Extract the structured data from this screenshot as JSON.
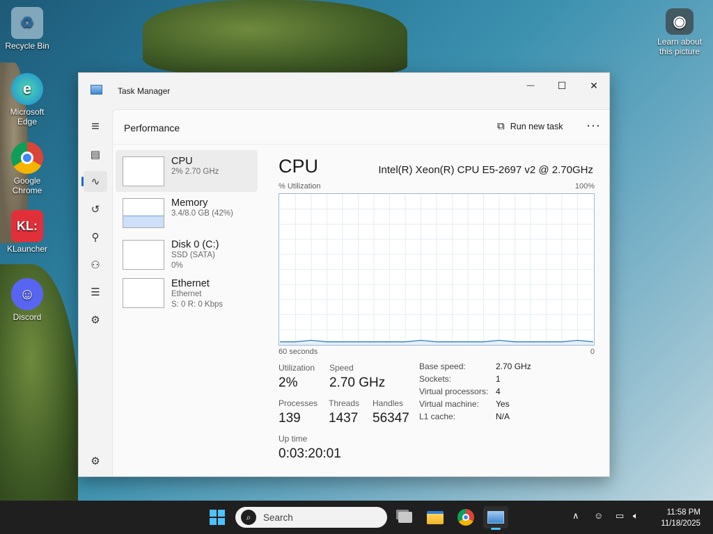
{
  "desktop": {
    "icons": [
      {
        "label": "Recycle Bin",
        "glyph": "♻",
        "color": "#9fb8cf"
      },
      {
        "label": "Microsoft Edge",
        "glyph": "e",
        "color": "#1b8ad6"
      },
      {
        "label": "Google Chrome",
        "glyph": "◎",
        "color": "#2f8a3f"
      },
      {
        "label": "KLauncher",
        "glyph": "KL",
        "color": "#e2303a"
      },
      {
        "label": "Discord",
        "glyph": "☺",
        "color": "#5865f2"
      }
    ],
    "learn_about": "Learn about this picture"
  },
  "window": {
    "title": "Task Manager",
    "controls": {
      "minimize": "—",
      "maximize": "☐",
      "close": "✕"
    }
  },
  "nav": {
    "items": [
      {
        "name": "hamburger-icon",
        "glyph": "≡"
      },
      {
        "name": "processes-icon",
        "glyph": "▤"
      },
      {
        "name": "performance-icon",
        "glyph": "∿"
      },
      {
        "name": "app-history-icon",
        "glyph": "↺"
      },
      {
        "name": "startup-apps-icon",
        "glyph": "⚲"
      },
      {
        "name": "users-icon",
        "glyph": "⚇"
      },
      {
        "name": "details-icon",
        "glyph": "☰"
      },
      {
        "name": "services-icon",
        "glyph": "⚙"
      },
      {
        "name": "settings-icon",
        "glyph": "⚙"
      }
    ]
  },
  "page": {
    "title": "Performance",
    "run_new_task": "Run new task",
    "more": "···"
  },
  "resources": [
    {
      "name": "CPU",
      "sub1": "2% 2.70 GHz",
      "sub2": "",
      "sub3": ""
    },
    {
      "name": "Memory",
      "sub1": "3.4/8.0 GB (42%)",
      "sub2": "",
      "sub3": ""
    },
    {
      "name": "Disk 0 (C:)",
      "sub1": "SSD (SATA)",
      "sub2": "0%",
      "sub3": ""
    },
    {
      "name": "Ethernet",
      "sub1": "Ethernet",
      "sub2": "S: 0 R: 0 Kbps",
      "sub3": ""
    }
  ],
  "memory_usage_fraction": 0.42,
  "detail": {
    "title": "CPU",
    "model": "Intel(R) Xeon(R) CPU E5-2697 v2 @ 2.70GHz",
    "y_label": "% Utilization",
    "y_max": "100%",
    "x_label": "60 seconds",
    "x_min": "0",
    "stats": {
      "utilization": {
        "k": "Utilization",
        "v": "2%"
      },
      "speed": {
        "k": "Speed",
        "v": "2.70 GHz"
      },
      "processes": {
        "k": "Processes",
        "v": "139"
      },
      "threads": {
        "k": "Threads",
        "v": "1437"
      },
      "handles": {
        "k": "Handles",
        "v": "56347"
      },
      "uptime": {
        "k": "Up time",
        "v": "0:03:20:01"
      }
    },
    "specs": [
      {
        "k": "Base speed:",
        "v": "2.70 GHz"
      },
      {
        "k": "Sockets:",
        "v": "1"
      },
      {
        "k": "Virtual processors:",
        "v": "4"
      },
      {
        "k": "Virtual machine:",
        "v": "Yes"
      },
      {
        "k": "L1 cache:",
        "v": "N/A"
      }
    ]
  },
  "chart_data": {
    "type": "line",
    "x": [
      60,
      57,
      54,
      51,
      48,
      45,
      42,
      39,
      36,
      33,
      30,
      27,
      24,
      21,
      18,
      15,
      12,
      9,
      6,
      3,
      0
    ],
    "series": [
      {
        "values": [
          2,
          2,
          3,
          2,
          2,
          2,
          2,
          2,
          2,
          3,
          2,
          2,
          2,
          2,
          3,
          2,
          2,
          2,
          2,
          3,
          2
        ]
      }
    ],
    "ylim": [
      0,
      100
    ],
    "xlim": [
      60,
      0
    ]
  },
  "taskbar": {
    "search_placeholder": "Search",
    "time": "11:58 PM",
    "date": "11/18/2025"
  }
}
